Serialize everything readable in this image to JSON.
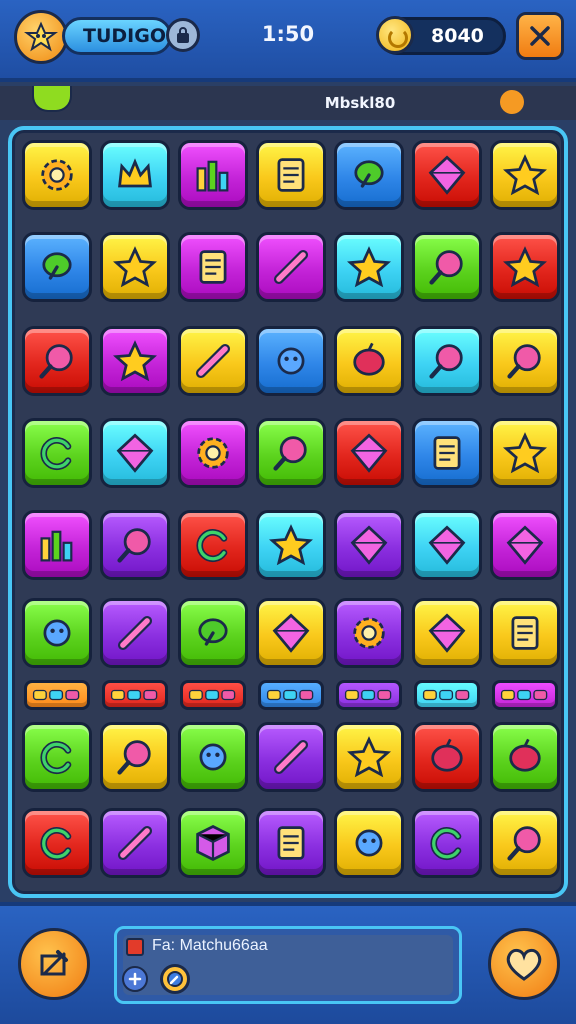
{
  "hud": {
    "player_name": "TUDIGO",
    "timer": "1:50",
    "coins": "8040",
    "avatar_icon": "owl-avatar-icon",
    "badge_icon": "lock-badge-icon",
    "close_icon": "close-icon"
  },
  "strip": {
    "level_label": "Mbskl80"
  },
  "colors": {
    "yellow": "#f9c81b",
    "cyan": "#3ed3f4",
    "magenta": "#c424d8",
    "red": "#e2261d",
    "blue": "#2f86e8",
    "green": "#5cd31e",
    "purple": "#8b2fe0",
    "orange": "#ff8a1a",
    "accent_border": "#49c6f5"
  },
  "board": {
    "rows": [
      [
        {
          "color": "yellow",
          "icon": "gear-icon"
        },
        {
          "color": "cyan",
          "icon": "crown-icon"
        },
        {
          "color": "magenta",
          "icon": "bar-chart-icon"
        },
        {
          "color": "yellow",
          "icon": "phone-icon"
        },
        {
          "color": "blue",
          "icon": "broccoli-icon"
        },
        {
          "color": "red",
          "icon": "diamond-gem-icon"
        },
        {
          "color": "yellow",
          "icon": "star-gem-icon"
        }
      ],
      [
        {
          "color": "blue",
          "icon": "leaf-icon"
        },
        {
          "color": "yellow",
          "icon": "star-icon"
        },
        {
          "color": "magenta",
          "icon": "image-frame-icon"
        },
        {
          "color": "magenta",
          "icon": "rainbow-slash-icon"
        },
        {
          "color": "cyan",
          "icon": "star-icon"
        },
        {
          "color": "green",
          "icon": "lollipop-icon"
        },
        {
          "color": "red",
          "icon": "star-icon"
        }
      ],
      [
        {
          "color": "red",
          "icon": "lollipop-icon"
        },
        {
          "color": "magenta",
          "icon": "star-icon"
        },
        {
          "color": "yellow",
          "icon": "cross-icon"
        },
        {
          "color": "blue",
          "icon": "rattle-icon"
        },
        {
          "color": "yellow",
          "icon": "apple-icon"
        },
        {
          "color": "cyan",
          "icon": "ring-icon"
        },
        {
          "color": "yellow",
          "icon": "lollipop-icon"
        }
      ],
      [
        {
          "color": "green",
          "icon": "compass-icon"
        },
        {
          "color": "cyan",
          "icon": "emerald-icon"
        },
        {
          "color": "magenta",
          "icon": "sun-burst-icon"
        },
        {
          "color": "green",
          "icon": "magnifier-icon"
        },
        {
          "color": "red",
          "icon": "oval-gem-icon"
        },
        {
          "color": "blue",
          "icon": "document-icon"
        },
        {
          "color": "yellow",
          "icon": "splat-star-icon"
        }
      ],
      [
        {
          "color": "magenta",
          "icon": "bar-chart-icon"
        },
        {
          "color": "purple",
          "icon": "magnifier-icon"
        },
        {
          "color": "red",
          "icon": "swirl-icon"
        },
        {
          "color": "cyan",
          "icon": "star-icon"
        },
        {
          "color": "purple",
          "icon": "pentagon-gem-icon"
        },
        {
          "color": "cyan",
          "icon": "leaf-gem-icon"
        },
        {
          "color": "magenta",
          "icon": "pentagon-gem-icon"
        }
      ],
      [
        {
          "color": "green",
          "icon": "monster-icon"
        },
        {
          "color": "purple",
          "icon": "rainbow-slash-icon"
        },
        {
          "color": "green",
          "icon": "wreath-icon"
        },
        {
          "color": "yellow",
          "icon": "diamond-icon"
        },
        {
          "color": "purple",
          "icon": "sun-icon"
        },
        {
          "color": "yellow",
          "icon": "oval-gem-icon"
        },
        {
          "color": "yellow",
          "icon": "frame-slash-icon"
        }
      ],
      [
        {
          "color": "orange",
          "icon": "striped-bar-icon"
        },
        {
          "color": "red",
          "icon": "arrow-bar-icon"
        },
        {
          "color": "red",
          "icon": "sparkle-bar-icon"
        },
        {
          "color": "blue",
          "icon": "rainbow-bar-icon"
        },
        {
          "color": "purple",
          "icon": "pattern-bar-icon"
        },
        {
          "color": "cyan",
          "icon": "ring-bar-icon"
        },
        {
          "color": "magenta",
          "icon": "symbol-bar-icon"
        }
      ],
      [
        {
          "color": "green",
          "icon": "spiral-icon"
        },
        {
          "color": "yellow",
          "icon": "lollipop-icon"
        },
        {
          "color": "green",
          "icon": "rattle-icon"
        },
        {
          "color": "purple",
          "icon": "capsule-icon"
        },
        {
          "color": "yellow",
          "icon": "star-wand-icon"
        },
        {
          "color": "red",
          "icon": "watermelon-icon"
        },
        {
          "color": "green",
          "icon": "planet-icon"
        }
      ],
      [
        {
          "color": "red",
          "icon": "letter-c-icon"
        },
        {
          "color": "purple",
          "icon": "pill-icon"
        },
        {
          "color": "green",
          "icon": "cube-icon"
        },
        {
          "color": "purple",
          "icon": "box-icon"
        },
        {
          "color": "yellow",
          "icon": "mace-icon"
        },
        {
          "color": "purple",
          "icon": "hook-icon"
        },
        {
          "color": "yellow",
          "icon": "lollipop-icon"
        }
      ]
    ]
  },
  "bottom": {
    "info_text": "Fa: Matchu66aa",
    "left_booster_icon": "hammer-icon",
    "right_booster_icon": "heart-icon",
    "info_icon_1": "plus-icon",
    "info_icon_2": "compass-icon"
  }
}
